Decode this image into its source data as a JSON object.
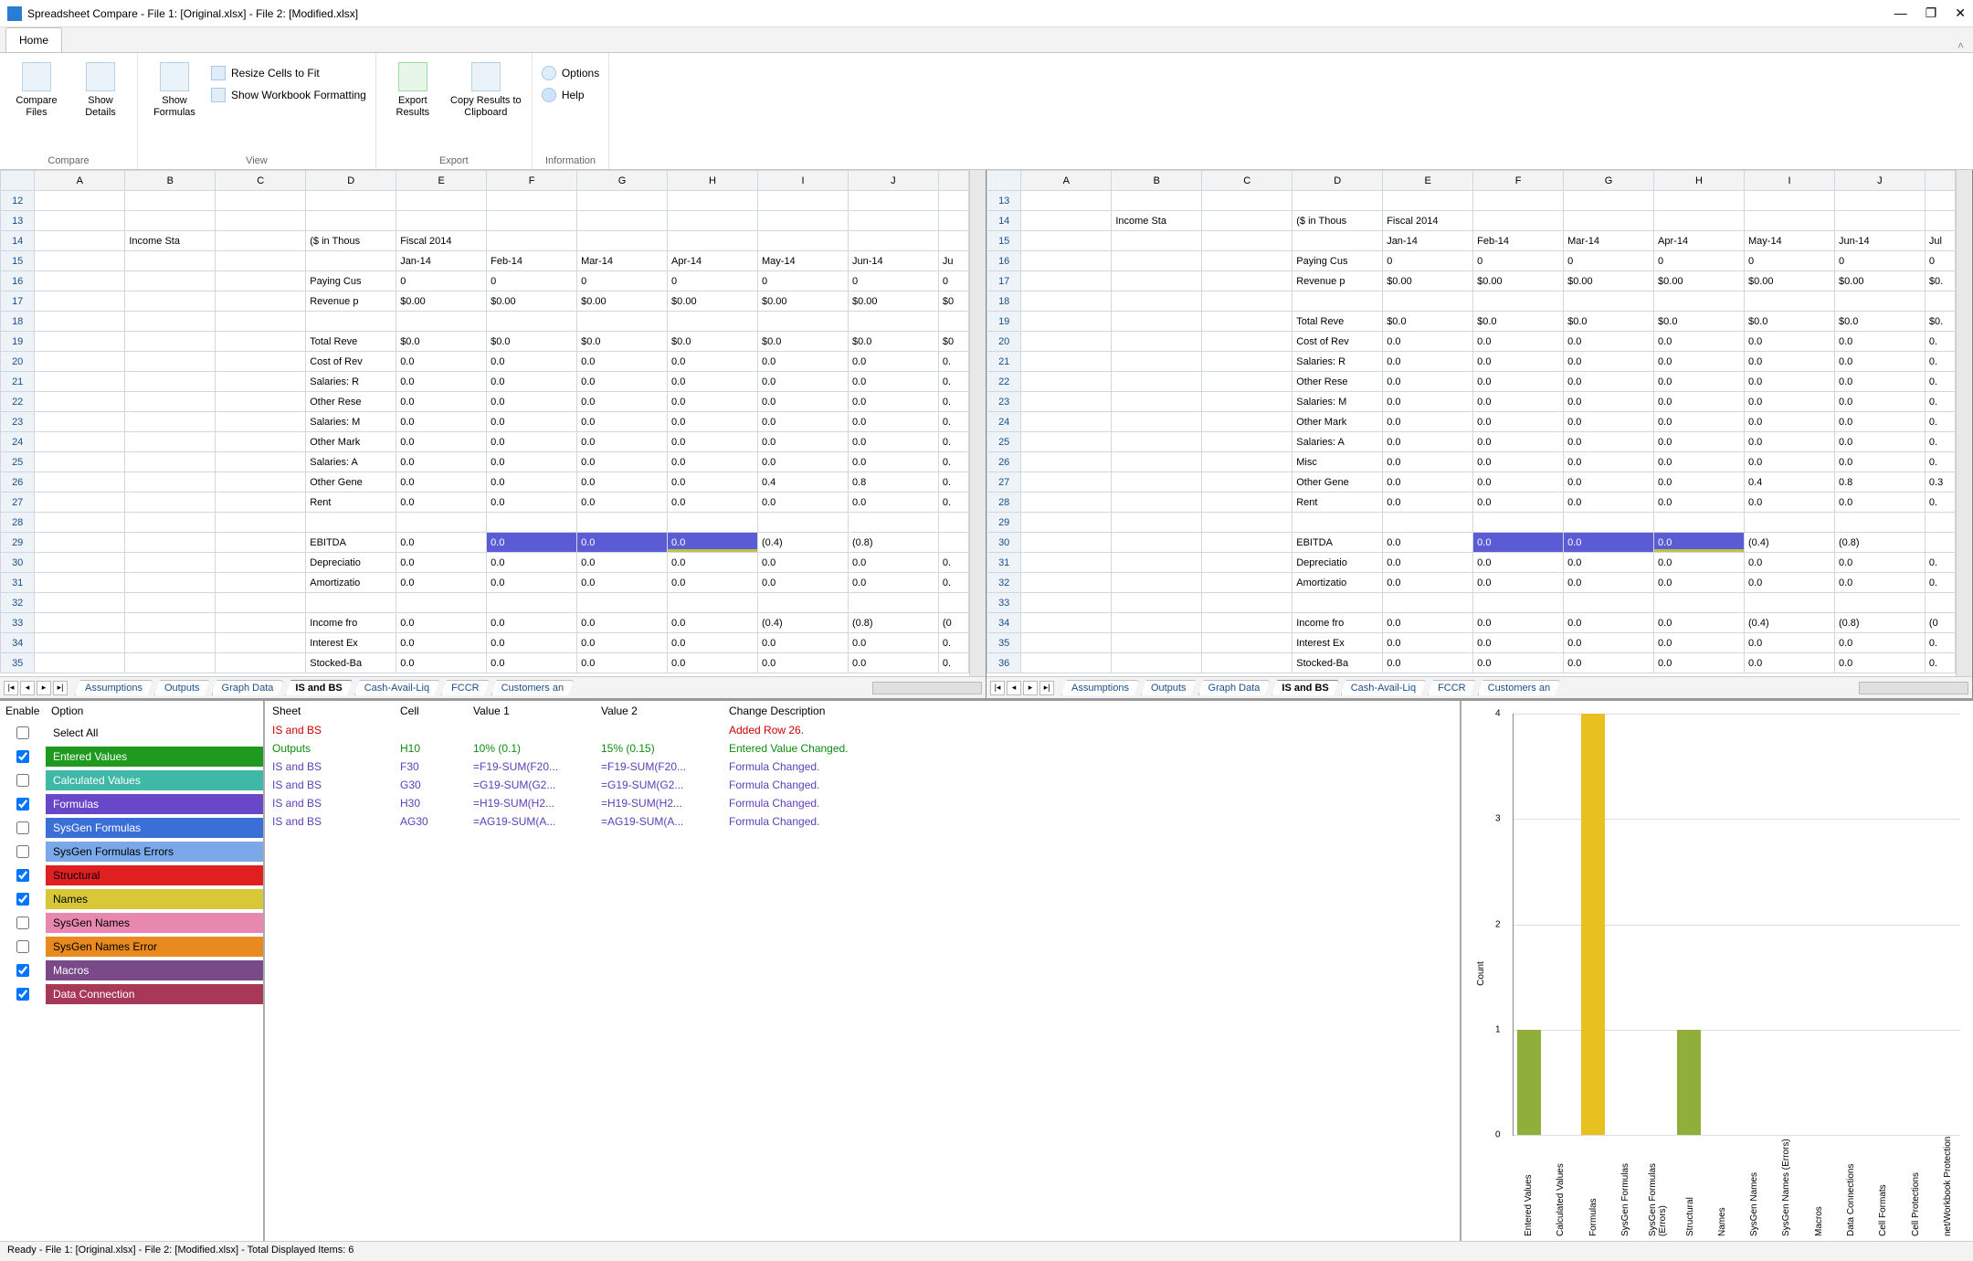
{
  "window": {
    "title": "Spreadsheet Compare - File 1: [Original.xlsx] - File 2: [Modified.xlsx]"
  },
  "ribbon": {
    "home_tab": "Home",
    "groups": {
      "compare": {
        "label": "Compare",
        "compare_files": "Compare\nFiles",
        "show_details": "Show\nDetails"
      },
      "view": {
        "label": "View",
        "show_formulas": "Show\nFormulas",
        "resize": "Resize Cells to Fit",
        "show_wb_fmt": "Show Workbook Formatting"
      },
      "export": {
        "label": "Export",
        "export_results": "Export\nResults",
        "copy_clip": "Copy Results\nto Clipboard"
      },
      "info": {
        "label": "Information",
        "options": "Options",
        "help": "Help"
      }
    }
  },
  "columns": [
    "A",
    "B",
    "C",
    "D",
    "E",
    "F",
    "G",
    "H",
    "I",
    "J"
  ],
  "left_pane": {
    "start_row": 12,
    "rows": [
      {
        "r": 12
      },
      {
        "r": 13
      },
      {
        "r": 14,
        "B": "Income Sta",
        "D": "($ in Thous",
        "E": "Fiscal 2014"
      },
      {
        "r": 15,
        "E": "Jan-14",
        "F": "Feb-14",
        "G": "Mar-14",
        "H": "Apr-14",
        "I": "May-14",
        "J": "Jun-14",
        "K": "Ju"
      },
      {
        "r": 16,
        "D": "Paying Cus",
        "E": "0",
        "F": "0",
        "G": "0",
        "H": "0",
        "I": "0",
        "J": "0",
        "K": "0"
      },
      {
        "r": 17,
        "D": "Revenue p",
        "E": "$0.00",
        "F": "$0.00",
        "G": "$0.00",
        "H": "$0.00",
        "I": "$0.00",
        "J": "$0.00",
        "K": "$0"
      },
      {
        "r": 18
      },
      {
        "r": 19,
        "D": "Total Reve",
        "E": "$0.0",
        "F": "$0.0",
        "G": "$0.0",
        "H": "$0.0",
        "I": "$0.0",
        "J": "$0.0",
        "K": "$0"
      },
      {
        "r": 20,
        "D": "Cost of Rev",
        "E": "0.0",
        "F": "0.0",
        "G": "0.0",
        "H": "0.0",
        "I": "0.0",
        "J": "0.0",
        "K": "0."
      },
      {
        "r": 21,
        "D": "Salaries: R",
        "E": "0.0",
        "F": "0.0",
        "G": "0.0",
        "H": "0.0",
        "I": "0.0",
        "J": "0.0",
        "K": "0."
      },
      {
        "r": 22,
        "D": "Other Rese",
        "E": "0.0",
        "F": "0.0",
        "G": "0.0",
        "H": "0.0",
        "I": "0.0",
        "J": "0.0",
        "K": "0."
      },
      {
        "r": 23,
        "D": "Salaries: M",
        "E": "0.0",
        "F": "0.0",
        "G": "0.0",
        "H": "0.0",
        "I": "0.0",
        "J": "0.0",
        "K": "0."
      },
      {
        "r": 24,
        "D": "Other Mark",
        "E": "0.0",
        "F": "0.0",
        "G": "0.0",
        "H": "0.0",
        "I": "0.0",
        "J": "0.0",
        "K": "0."
      },
      {
        "r": 25,
        "D": "Salaries: A",
        "E": "0.0",
        "F": "0.0",
        "G": "0.0",
        "H": "0.0",
        "I": "0.0",
        "J": "0.0",
        "K": "0."
      },
      {
        "r": 26,
        "D": "Other Gene",
        "E": "0.0",
        "F": "0.0",
        "G": "0.0",
        "H": "0.0",
        "I": "0.4",
        "J": "0.8",
        "K": "0."
      },
      {
        "r": 27,
        "D": "Rent",
        "E": "0.0",
        "F": "0.0",
        "G": "0.0",
        "H": "0.0",
        "I": "0.0",
        "J": "0.0",
        "K": "0."
      },
      {
        "r": 28
      },
      {
        "r": 29,
        "D": "EBITDA",
        "E": "0.0",
        "F": "0.0",
        "G": "0.0",
        "H": "0.0",
        "I": "(0.4)",
        "J": "(0.8)",
        "K": "",
        "hl": [
          "F",
          "G",
          "H"
        ]
      },
      {
        "r": 30,
        "D": "Depreciatio",
        "E": "0.0",
        "F": "0.0",
        "G": "0.0",
        "H": "0.0",
        "I": "0.0",
        "J": "0.0",
        "K": "0."
      },
      {
        "r": 31,
        "D": "Amortizatio",
        "E": "0.0",
        "F": "0.0",
        "G": "0.0",
        "H": "0.0",
        "I": "0.0",
        "J": "0.0",
        "K": "0."
      },
      {
        "r": 32
      },
      {
        "r": 33,
        "D": "Income fro",
        "E": "0.0",
        "F": "0.0",
        "G": "0.0",
        "H": "0.0",
        "I": "(0.4)",
        "J": "(0.8)",
        "K": "(0"
      },
      {
        "r": 34,
        "D": "Interest Ex",
        "E": "0.0",
        "F": "0.0",
        "G": "0.0",
        "H": "0.0",
        "I": "0.0",
        "J": "0.0",
        "K": "0."
      },
      {
        "r": 35,
        "D": "Stocked-Ba",
        "E": "0.0",
        "F": "0.0",
        "G": "0.0",
        "H": "0.0",
        "I": "0.0",
        "J": "0.0",
        "K": "0."
      }
    ]
  },
  "right_pane": {
    "start_row": 13,
    "rows": [
      {
        "r": 13
      },
      {
        "r": 14,
        "B": "Income Sta",
        "D": "($ in Thous",
        "E": "Fiscal 2014"
      },
      {
        "r": 15,
        "E": "Jan-14",
        "F": "Feb-14",
        "G": "Mar-14",
        "H": "Apr-14",
        "I": "May-14",
        "J": "Jun-14",
        "K": "Jul"
      },
      {
        "r": 16,
        "D": "Paying Cus",
        "E": "0",
        "F": "0",
        "G": "0",
        "H": "0",
        "I": "0",
        "J": "0",
        "K": "0"
      },
      {
        "r": 17,
        "D": "Revenue p",
        "E": "$0.00",
        "F": "$0.00",
        "G": "$0.00",
        "H": "$0.00",
        "I": "$0.00",
        "J": "$0.00",
        "K": "$0."
      },
      {
        "r": 18
      },
      {
        "r": 19,
        "D": "Total Reve",
        "E": "$0.0",
        "F": "$0.0",
        "G": "$0.0",
        "H": "$0.0",
        "I": "$0.0",
        "J": "$0.0",
        "K": "$0."
      },
      {
        "r": 20,
        "D": "Cost of Rev",
        "E": "0.0",
        "F": "0.0",
        "G": "0.0",
        "H": "0.0",
        "I": "0.0",
        "J": "0.0",
        "K": "0."
      },
      {
        "r": 21,
        "D": "Salaries: R",
        "E": "0.0",
        "F": "0.0",
        "G": "0.0",
        "H": "0.0",
        "I": "0.0",
        "J": "0.0",
        "K": "0."
      },
      {
        "r": 22,
        "D": "Other Rese",
        "E": "0.0",
        "F": "0.0",
        "G": "0.0",
        "H": "0.0",
        "I": "0.0",
        "J": "0.0",
        "K": "0."
      },
      {
        "r": 23,
        "D": "Salaries: M",
        "E": "0.0",
        "F": "0.0",
        "G": "0.0",
        "H": "0.0",
        "I": "0.0",
        "J": "0.0",
        "K": "0."
      },
      {
        "r": 24,
        "D": "Other Mark",
        "E": "0.0",
        "F": "0.0",
        "G": "0.0",
        "H": "0.0",
        "I": "0.0",
        "J": "0.0",
        "K": "0."
      },
      {
        "r": 25,
        "D": "Salaries: A",
        "E": "0.0",
        "F": "0.0",
        "G": "0.0",
        "H": "0.0",
        "I": "0.0",
        "J": "0.0",
        "K": "0."
      },
      {
        "r": 26,
        "D": "Misc",
        "E": "0.0",
        "F": "0.0",
        "G": "0.0",
        "H": "0.0",
        "I": "0.0",
        "J": "0.0",
        "K": "0."
      },
      {
        "r": 27,
        "D": "Other Gene",
        "E": "0.0",
        "F": "0.0",
        "G": "0.0",
        "H": "0.0",
        "I": "0.4",
        "J": "0.8",
        "K": "0.3"
      },
      {
        "r": 28,
        "D": "Rent",
        "E": "0.0",
        "F": "0.0",
        "G": "0.0",
        "H": "0.0",
        "I": "0.0",
        "J": "0.0",
        "K": "0."
      },
      {
        "r": 29
      },
      {
        "r": 30,
        "D": "EBITDA",
        "E": "0.0",
        "F": "0.0",
        "G": "0.0",
        "H": "0.0",
        "I": "(0.4)",
        "J": "(0.8)",
        "K": "",
        "hl": [
          "F",
          "G",
          "H"
        ]
      },
      {
        "r": 31,
        "D": "Depreciatio",
        "E": "0.0",
        "F": "0.0",
        "G": "0.0",
        "H": "0.0",
        "I": "0.0",
        "J": "0.0",
        "K": "0."
      },
      {
        "r": 32,
        "D": "Amortizatio",
        "E": "0.0",
        "F": "0.0",
        "G": "0.0",
        "H": "0.0",
        "I": "0.0",
        "J": "0.0",
        "K": "0."
      },
      {
        "r": 33
      },
      {
        "r": 34,
        "D": "Income fro",
        "E": "0.0",
        "F": "0.0",
        "G": "0.0",
        "H": "0.0",
        "I": "(0.4)",
        "J": "(0.8)",
        "K": "(0"
      },
      {
        "r": 35,
        "D": "Interest Ex",
        "E": "0.0",
        "F": "0.0",
        "G": "0.0",
        "H": "0.0",
        "I": "0.0",
        "J": "0.0",
        "K": "0."
      },
      {
        "r": 36,
        "D": "Stocked-Ba",
        "E": "0.0",
        "F": "0.0",
        "G": "0.0",
        "H": "0.0",
        "I": "0.0",
        "J": "0.0",
        "K": "0."
      }
    ]
  },
  "sheet_tabs": [
    "Assumptions",
    "Outputs",
    "Graph Data",
    "IS and BS",
    "Cash-Avail-Liq",
    "FCCR",
    "Customers an"
  ],
  "sheet_tabs_active": "IS and BS",
  "options": {
    "hdr_enable": "Enable",
    "hdr_option": "Option",
    "items": [
      {
        "label": "Select All",
        "checked": false,
        "bg": "#ffffff",
        "fg": "#000"
      },
      {
        "label": "Entered Values",
        "checked": true,
        "bg": "#1f9a1f",
        "fg": "#fff"
      },
      {
        "label": "Calculated Values",
        "checked": false,
        "bg": "#3fb8a8",
        "fg": "#fff"
      },
      {
        "label": "Formulas",
        "checked": true,
        "bg": "#6848c8",
        "fg": "#fff"
      },
      {
        "label": "SysGen Formulas",
        "checked": false,
        "bg": "#3a6fd8",
        "fg": "#fff"
      },
      {
        "label": "SysGen Formulas Errors",
        "checked": false,
        "bg": "#7aa8e8",
        "fg": "#000"
      },
      {
        "label": "Structural",
        "checked": true,
        "bg": "#e02020",
        "fg": "#000"
      },
      {
        "label": "Names",
        "checked": true,
        "bg": "#d8c838",
        "fg": "#000"
      },
      {
        "label": "SysGen Names",
        "checked": false,
        "bg": "#e888b0",
        "fg": "#000"
      },
      {
        "label": "SysGen Names Error",
        "checked": false,
        "bg": "#e88a20",
        "fg": "#000"
      },
      {
        "label": "Macros",
        "checked": true,
        "bg": "#7a4a88",
        "fg": "#fff"
      },
      {
        "label": "Data Connection",
        "checked": true,
        "bg": "#a83858",
        "fg": "#fff"
      }
    ]
  },
  "diffs": {
    "headers": {
      "sheet": "Sheet",
      "cell": "Cell",
      "v1": "Value 1",
      "v2": "Value 2",
      "desc": "Change Description"
    },
    "rows": [
      {
        "cls": "redrow",
        "sheet": "IS and BS",
        "cell": "",
        "v1": "",
        "v2": "",
        "desc": "Added Row 26."
      },
      {
        "cls": "greenrow",
        "sheet": "Outputs",
        "cell": "H10",
        "v1": "10%  (0.1)",
        "v2": "15%  (0.15)",
        "desc": "Entered Value Changed."
      },
      {
        "cls": "purplerow",
        "sheet": "IS and BS",
        "cell": "F30",
        "v1": "=F19-SUM(F20...",
        "v2": "=F19-SUM(F20...",
        "desc": "Formula Changed."
      },
      {
        "cls": "purplerow",
        "sheet": "IS and BS",
        "cell": "G30",
        "v1": "=G19-SUM(G2...",
        "v2": "=G19-SUM(G2...",
        "desc": "Formula Changed."
      },
      {
        "cls": "purplerow",
        "sheet": "IS and BS",
        "cell": "H30",
        "v1": "=H19-SUM(H2...",
        "v2": "=H19-SUM(H2...",
        "desc": "Formula Changed."
      },
      {
        "cls": "purplerow",
        "sheet": "IS and BS",
        "cell": "AG30",
        "v1": "=AG19-SUM(A...",
        "v2": "=AG19-SUM(A...",
        "desc": "Formula Changed."
      }
    ]
  },
  "chart_data": {
    "type": "bar",
    "ylabel": "Count",
    "ylim": [
      0,
      4
    ],
    "yticks": [
      0,
      1,
      2,
      3,
      4
    ],
    "categories": [
      "Entered Values",
      "Calculated Values",
      "Formulas",
      "SysGen Formulas",
      "SysGen Formulas (Errors)",
      "Structural",
      "Names",
      "SysGen Names",
      "SysGen Names (Errors)",
      "Macros",
      "Data Connections",
      "Cell Formats",
      "Cell Protections",
      "net/Workbook Protection"
    ],
    "values": [
      1,
      0,
      4,
      0,
      0,
      1,
      0,
      0,
      0,
      0,
      0,
      0,
      0,
      0
    ],
    "colors": [
      "#8fae3a",
      "#3fb8a8",
      "#e8c020",
      "#3a6fd8",
      "#7aa8e8",
      "#8fae3a",
      "#d8c838",
      "#e888b0",
      "#e88a20",
      "#7a4a88",
      "#a83858",
      "#888",
      "#888",
      "#888"
    ]
  },
  "status": "Ready - File 1: [Original.xlsx] - File 2: [Modified.xlsx] - Total Displayed Items: 6"
}
